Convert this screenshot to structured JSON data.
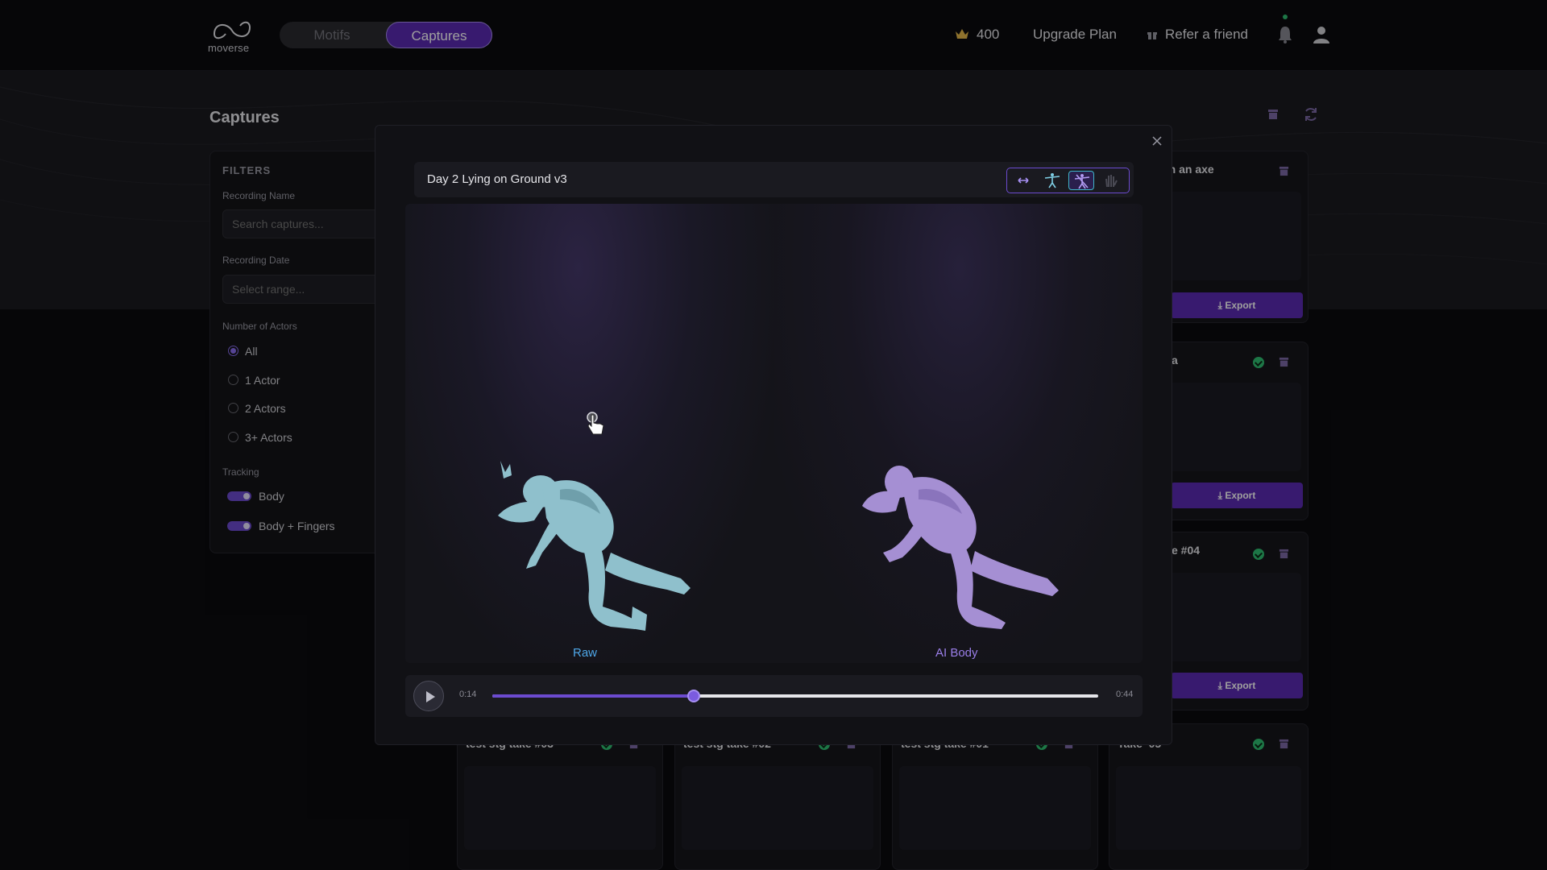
{
  "app": {
    "logo_text": "moverse"
  },
  "nav": {
    "tabs": [
      {
        "label": "Motifs"
      },
      {
        "label": "Captures"
      }
    ]
  },
  "header": {
    "credits": "400",
    "upgrade_label": "Upgrade Plan",
    "refer_label": "Refer a friend"
  },
  "page": {
    "title": "Captures"
  },
  "filters": {
    "heading": "FILTERS",
    "recording_name_label": "Recording Name",
    "search_placeholder": "Search captures...",
    "recording_date_label": "Recording Date",
    "date_placeholder": "Select range...",
    "actors_label": "Number of Actors",
    "actor_options": [
      {
        "label": "All",
        "selected": true
      },
      {
        "label": "1 Actor"
      },
      {
        "label": "2 Actors"
      },
      {
        "label": "3+ Actors"
      }
    ],
    "tracking_label": "Tracking",
    "tracking_options": [
      {
        "label": "Body",
        "on": true
      },
      {
        "label": "Body + Fingers",
        "on": true
      }
    ]
  },
  "cards": {
    "right": [
      {
        "title": "th an axe"
      },
      {
        "title": "a"
      },
      {
        "title": "e #04"
      },
      {
        "title": "Take ‘05"
      }
    ],
    "bottom": [
      {
        "title": "test stg take #03"
      },
      {
        "title": "test stg take #02"
      },
      {
        "title": "test stg take #01"
      }
    ],
    "export_label": "Export"
  },
  "modal": {
    "title": "Day 2 Lying on Ground v3",
    "left_label": "Raw",
    "right_label": "AI Body",
    "player": {
      "current": "0:14",
      "end": "0:44",
      "progress": 0.333
    }
  },
  "colors": {
    "accent": "#5b2bb3",
    "raw": "#8fc4d0",
    "ai": "#a78fd6",
    "success": "#2fbf71"
  }
}
